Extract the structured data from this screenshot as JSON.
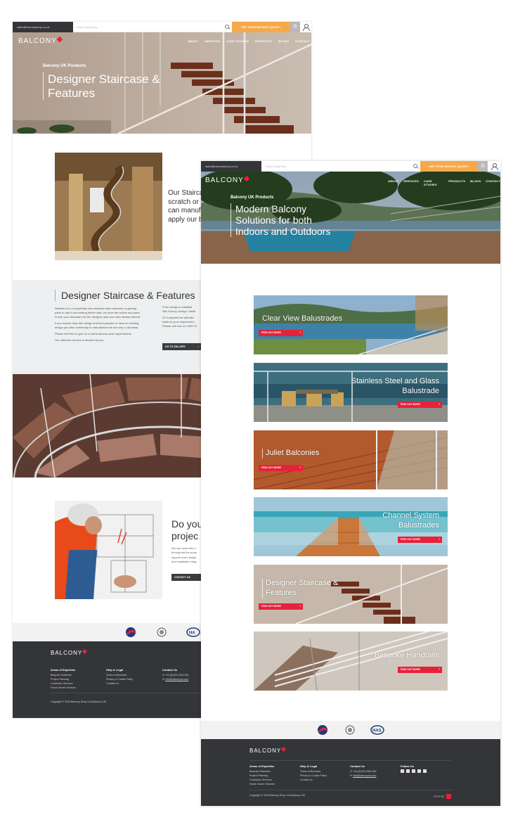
{
  "colors": {
    "accent": "#e6223a",
    "quote": "#f6a94a",
    "dark": "#343538"
  },
  "left_page": {
    "topbar": {
      "email": "sales@balconyshop.co.uk",
      "search_placeholder": "Search anything...",
      "quote_label": "GET YOUR INSTANT QUOTE ›"
    },
    "logo": "BALCONY",
    "nav": [
      "ABOUT",
      "SERVICES",
      "CASE STUDIES",
      "PRODUCTS",
      "BLOGS",
      "CONTACT"
    ],
    "hero": {
      "kicker": "Balcony UK Products",
      "title_line1": "Designer Staircase &",
      "title_line2": "Features"
    },
    "intro_lines": [
      "Our Staircas",
      "scratch or ad",
      "can manufa",
      "apply our be"
    ],
    "section": {
      "title": "Designer Staircase & Features",
      "col1": [
        "Whether it is a completely new stainless steel staircase or glazing",
        "parts to add to an existing timber stair, we have the advice and parts",
        "to turn your staircase into the designer stair you have always wished.",
        "If you require help with design and best practice or have an existing",
        "design you wish somebody to manufacture we are only a call away.",
        "Please feel free to give us a call to discuss your requirements.",
        "Our staircase service is decided by you."
      ],
      "col2": [
        "From design to installati",
        "Site Survey, Design, Detail",
        "Or if required we will take",
        "make to your requirement",
        "Please call now on 0333 23"
      ],
      "gallery_button": "GO TO GALLERY"
    },
    "doyou": {
      "line1": "Do you",
      "line2": "projec",
      "copy": [
        "We can work with a",
        "throughout the proje",
        "support your design",
        "and installation stag"
      ],
      "contact_button": "CONTACT US"
    },
    "footer": {
      "logo": "BALCONY",
      "col1_title": "Areas of Expertise",
      "col1": [
        "Bespoke Solutions",
        "Project Planning",
        "Contractor Services",
        "Home Owner Services"
      ],
      "col2_title": "Help & Legal",
      "col2": [
        "Terms of Business",
        "Privacy & Cookie Policy",
        "Contact Us"
      ],
      "col3_title": "Contact Us",
      "phone": "+44 (0)333 2345 383",
      "email": "info@balconyuk.com",
      "copyright": "Copyright © 2018 Balcony Shop Ltd (Balcony UK)"
    }
  },
  "right_page": {
    "topbar": {
      "email": "sales@balconyshop.co.uk",
      "search_placeholder": "Search anything...",
      "quote_label": "GET YOUR INSTANT QUOTE ›"
    },
    "logo": "BALCONY",
    "nav": [
      "ABOUT",
      "SERVICES",
      "CASE STUDIES",
      "PRODUCTS",
      "BLOGS",
      "CONTACT"
    ],
    "hero": {
      "kicker": "Balcony UK Products",
      "title_line1": "Modern Balcony",
      "title_line2": "Solutions for both",
      "title_line3": "Indoors and Outdoors"
    },
    "cards": [
      {
        "title_line1": "Clear View Balustrades",
        "title_line2": "",
        "button": "FIND OUT MORE"
      },
      {
        "title_line1": "Stainless Steel and Glass",
        "title_line2": "Balustrade",
        "button": "FIND OUT MORE"
      },
      {
        "title_line1": "Juliet Balconies",
        "title_line2": "",
        "button": "FIND OUT MORE"
      },
      {
        "title_line1": "Channel System",
        "title_line2": "Balustrades",
        "button": "FIND OUT MORE"
      },
      {
        "title_line1": "Designer Staircase &",
        "title_line2": "Features",
        "button": "FIND OUT MORE"
      },
      {
        "title_line1": "Bespoke Handrails",
        "title_line2": "",
        "button": "FIND OUT MORE"
      }
    ],
    "footer": {
      "logo": "BALCONY",
      "col1_title": "Areas of Expertise",
      "col1": [
        "Bespoke Solutions",
        "Project Planning",
        "Contractor Services",
        "Home Owner Services"
      ],
      "col2_title": "Help & Legal",
      "col2": [
        "Terms of Business",
        "Privacy & Cookie Policy",
        "Contact Us"
      ],
      "col3_title": "Contact Us",
      "phone": "+44 (0)333 2345 383",
      "email": "info@balconyuk.com",
      "col4_title": "Follow Us",
      "copyright": "Copyright © 2018 Balcony Shop Ltd (Balcony UK)",
      "to_top": "Go to top"
    }
  }
}
